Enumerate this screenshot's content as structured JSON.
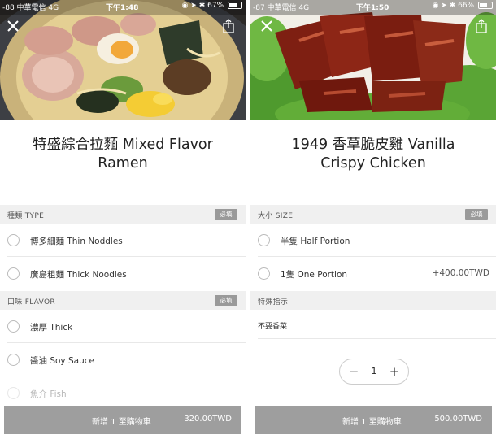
{
  "left": {
    "status": {
      "carrier": "-88 中華電信  4G",
      "time": "下午1:48",
      "battery": "67%",
      "battery_level": 0.67
    },
    "dish_title_line1": "特盛綜合拉麵 Mixed Flavor",
    "dish_title_line2": "Ramen",
    "sections": {
      "type": {
        "label": "種類 TYPE",
        "badge": "必填",
        "options": [
          "博多細麵 Thin Noddles",
          "廣島粗麵 Thick Noodles"
        ]
      },
      "flavor": {
        "label": "口味 FLAVOR",
        "badge": "必填",
        "options": [
          "濃厚 Thick",
          "醬油 Soy Sauce",
          "魚介 Fish"
        ]
      }
    },
    "cart": {
      "label": "新增 1 至購物車",
      "price": "320.00TWD"
    }
  },
  "right": {
    "status": {
      "carrier": "-87 中華電信  4G",
      "time": "下午1:50",
      "battery": "66%",
      "battery_level": 0.66
    },
    "dish_title_line1": "1949 香草脆皮雞 Vanilla",
    "dish_title_line2": "Crispy Chicken",
    "sections": {
      "size": {
        "label": "大小 SIZE",
        "badge": "必填",
        "options": [
          {
            "label": "半隻 Half Portion",
            "price": ""
          },
          {
            "label": "1隻 One Portion",
            "price": "+400.00TWD"
          }
        ]
      },
      "instructions": {
        "label": "特殊指示",
        "value": "不要香菜"
      }
    },
    "quantity": {
      "minus": "−",
      "value": "1",
      "plus": "+"
    },
    "cart": {
      "label": "新增 1 至購物車",
      "price": "500.00TWD"
    }
  },
  "colors": {
    "section_bg": "#f0f0f0",
    "badge_bg": "#9a9a9a",
    "cart_bg": "#9e9e9e"
  },
  "icons": [
    "close-icon",
    "share-icon",
    "location-icon",
    "bluetooth-icon",
    "battery-icon",
    "radio-icon"
  ]
}
